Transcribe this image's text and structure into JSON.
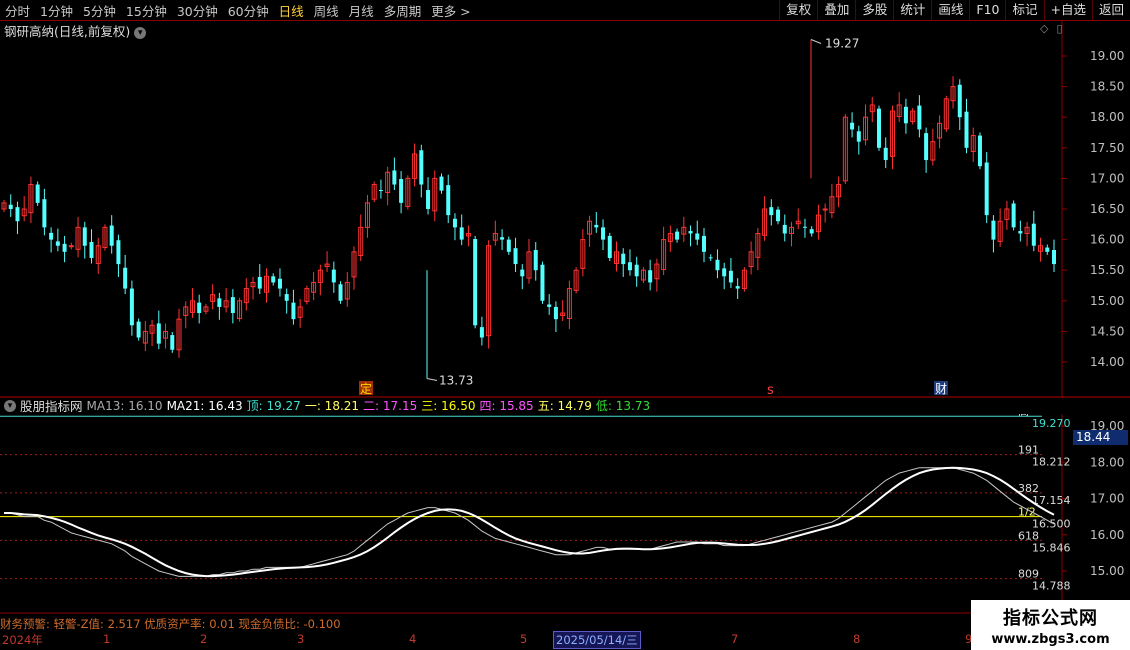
{
  "periods": [
    "分时",
    "1分钟",
    "5分钟",
    "15分钟",
    "30分钟",
    "60分钟",
    "日线",
    "周线",
    "月线",
    "多周期",
    "更多 >"
  ],
  "active_period": "日线",
  "right_buttons": [
    "复权",
    "叠加",
    "多股",
    "统计",
    "画线",
    "F10",
    "标记",
    "+自选",
    "返回"
  ],
  "main_title": "钢研高纳(日线,前复权)",
  "price_axis": [
    "19.00",
    "18.50",
    "18.00",
    "17.50",
    "17.00",
    "16.50",
    "16.00",
    "15.50",
    "15.00",
    "14.50",
    "14.00"
  ],
  "high_label": "19.27",
  "low_label": "13.73",
  "markers": {
    "ding": "定",
    "s": "s",
    "cai": "财"
  },
  "indicator": {
    "name": "股朋指标网",
    "ma13": "MA13: 16.10",
    "ma21": "MA21: 16.43",
    "ding": "顶: 19.27",
    "yi": "一: 18.21",
    "er": "二: 17.15",
    "san": "三: 16.50",
    "si": "四: 15.85",
    "wu": "五: 14.79",
    "di": "低: 13.73"
  },
  "ind_axis": [
    "19.00",
    "18.00",
    "17.00",
    "16.00",
    "15.00"
  ],
  "current_price": "18.44",
  "fib_labels": [
    {
      "tag": "高",
      "val": "19.270"
    },
    {
      "tag": "191",
      "val": "18.212"
    },
    {
      "tag": "382",
      "val": "17.154"
    },
    {
      "tag": "1/2",
      "val": "16.500"
    },
    {
      "tag": "618",
      "val": "15.846"
    },
    {
      "tag": "809",
      "val": "14.788"
    }
  ],
  "alert_text": "财务预警: 轻警-Z值: 2.517 优质资产率: 0.01 现金负债比: -0.100",
  "date_ticks": [
    "2024年",
    "1",
    "2",
    "3",
    "4",
    "5",
    "7",
    "8",
    "9"
  ],
  "selected_date": "2025/05/14/三",
  "watermark": {
    "line1": "指标公式网",
    "line2": "www.zbgs3.com"
  },
  "colors": {
    "up": "#ff3232",
    "down": "#54ffff",
    "ma13": "#c8c8c8",
    "ma21": "#ffffff",
    "half": "#ffff00",
    "top": "#40e0d0"
  },
  "chart_data": {
    "type": "candlestick",
    "title": "钢研高纳(日线,前复权)",
    "y_range": [
      13.5,
      19.5
    ],
    "high": 19.27,
    "low": 13.73,
    "levels": {
      "顶": 19.27,
      "一": 18.21,
      "二": 17.15,
      "三": 16.5,
      "四": 15.85,
      "五": 14.79,
      "低": 13.73
    },
    "closes": [
      16.6,
      16.5,
      16.3,
      16.5,
      16.9,
      16.6,
      16.2,
      16.0,
      15.9,
      15.8,
      15.9,
      16.2,
      15.9,
      15.7,
      15.9,
      16.2,
      15.9,
      15.6,
      15.2,
      14.6,
      14.4,
      14.5,
      14.6,
      14.3,
      14.5,
      14.2,
      14.7,
      14.9,
      15.0,
      14.8,
      14.9,
      15.1,
      14.9,
      15.0,
      14.8,
      15.0,
      15.2,
      15.3,
      15.2,
      15.4,
      15.3,
      15.2,
      15.0,
      14.7,
      14.9,
      15.2,
      15.3,
      15.5,
      15.6,
      15.3,
      15.0,
      15.3,
      15.8,
      16.2,
      16.6,
      16.9,
      16.8,
      17.1,
      16.9,
      16.6,
      17.0,
      17.4,
      16.9,
      16.5,
      17.0,
      16.8,
      16.4,
      16.2,
      16.0,
      16.1,
      14.6,
      14.4,
      15.9,
      16.1,
      16.0,
      15.8,
      15.6,
      15.4,
      15.8,
      15.5,
      15.0,
      14.9,
      14.7,
      14.8,
      15.2,
      15.5,
      16.0,
      16.3,
      16.2,
      16.0,
      15.7,
      15.8,
      15.6,
      15.5,
      15.4,
      15.5,
      15.3,
      15.6,
      16.0,
      16.1,
      16.0,
      16.2,
      16.1,
      16.0,
      15.8,
      15.7,
      15.5,
      15.4,
      15.3,
      15.2,
      15.5,
      15.8,
      16.1,
      16.5,
      16.4,
      16.3,
      16.1,
      16.2,
      16.3,
      16.2,
      16.1,
      16.4,
      16.5,
      16.7,
      16.9,
      18.0,
      17.8,
      17.6,
      18.0,
      18.2,
      17.5,
      17.3,
      18.1,
      18.2,
      17.9,
      18.1,
      17.8,
      17.3,
      17.6,
      17.9,
      18.3,
      18.5,
      18.0,
      17.5,
      17.7,
      17.2,
      16.4,
      16.0,
      16.3,
      16.5,
      16.2,
      16.1,
      16.2,
      15.9,
      15.9,
      15.8,
      15.6
    ],
    "ma13": [
      16.6,
      16.6,
      16.55,
      16.5,
      16.5,
      16.5,
      16.4,
      16.35,
      16.25,
      16.15,
      16.05,
      16.0,
      15.95,
      15.9,
      15.85,
      15.8,
      15.75,
      15.65,
      15.55,
      15.4,
      15.3,
      15.2,
      15.1,
      15.0,
      14.95,
      14.9,
      14.85,
      14.85,
      14.85,
      14.85,
      14.85,
      14.9,
      14.9,
      14.95,
      14.95,
      15.0,
      15.0,
      15.05,
      15.05,
      15.1,
      15.1,
      15.1,
      15.1,
      15.1,
      15.1,
      15.15,
      15.2,
      15.25,
      15.3,
      15.35,
      15.4,
      15.45,
      15.55,
      15.7,
      15.85,
      16.0,
      16.15,
      16.3,
      16.4,
      16.5,
      16.6,
      16.65,
      16.7,
      16.75,
      16.75,
      16.7,
      16.65,
      16.6,
      16.5,
      16.4,
      16.25,
      16.1,
      16.0,
      15.9,
      15.85,
      15.8,
      15.75,
      15.7,
      15.65,
      15.6,
      15.55,
      15.5,
      15.45,
      15.45,
      15.45,
      15.5,
      15.55,
      15.6,
      15.65,
      15.65,
      15.6,
      15.6,
      15.6,
      15.6,
      15.6,
      15.6,
      15.6,
      15.65,
      15.7,
      15.75,
      15.8,
      15.8,
      15.8,
      15.8,
      15.75,
      15.75,
      15.75,
      15.7,
      15.7,
      15.7,
      15.7,
      15.75,
      15.8,
      15.85,
      15.9,
      15.95,
      16.0,
      16.05,
      16.1,
      16.15,
      16.2,
      16.25,
      16.3,
      16.35,
      16.45,
      16.6,
      16.75,
      16.9,
      17.05,
      17.2,
      17.35,
      17.5,
      17.6,
      17.7,
      17.75,
      17.8,
      17.85,
      17.85,
      17.85,
      17.85,
      17.85,
      17.85,
      17.8,
      17.75,
      17.7,
      17.6,
      17.5,
      17.35,
      17.2,
      17.05,
      16.9,
      16.8,
      16.7,
      16.6,
      16.5,
      16.4,
      16.3
    ]
  }
}
